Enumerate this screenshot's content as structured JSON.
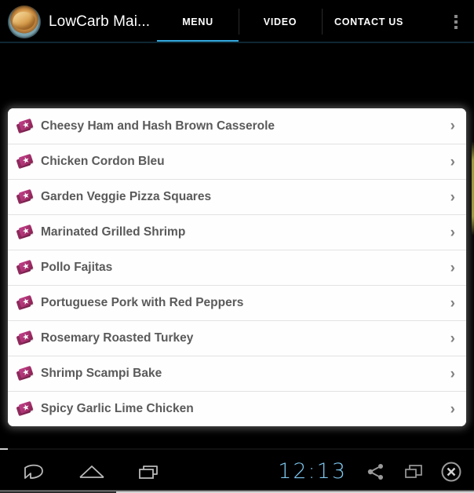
{
  "header": {
    "title": "LowCarb Mai...",
    "logo_icon": "app-logo-food-photo",
    "tabs": [
      {
        "label": "MENU",
        "active": true
      },
      {
        "label": "VIDEO",
        "active": false
      },
      {
        "label": "CONTACT US",
        "active": false
      }
    ],
    "overflow_icon": "overflow-menu-icon",
    "active_tab_color": "#33a8dd"
  },
  "list": {
    "row_icon": "recipe-card-icon",
    "chevron_icon": "chevron-right-icon",
    "items": [
      {
        "label": "Cheesy Ham and Hash Brown Casserole"
      },
      {
        "label": "Chicken Cordon Bleu"
      },
      {
        "label": "Garden Veggie Pizza Squares"
      },
      {
        "label": "Marinated Grilled Shrimp"
      },
      {
        "label": "Pollo Fajitas"
      },
      {
        "label": "Portuguese Pork with Red Peppers"
      },
      {
        "label": "Rosemary Roasted Turkey"
      },
      {
        "label": "Shrimp Scampi Bake"
      },
      {
        "label": "Spicy Garlic Lime Chicken"
      }
    ]
  },
  "navbar": {
    "back_icon": "back-icon",
    "home_icon": "home-icon",
    "recents_icon": "recent-apps-icon",
    "clock": "12:13",
    "share_icon": "share-icon",
    "screenshot_icon": "screenshot-icon",
    "close_icon": "close-circle-icon",
    "clock_color": "#7ec8ef"
  }
}
